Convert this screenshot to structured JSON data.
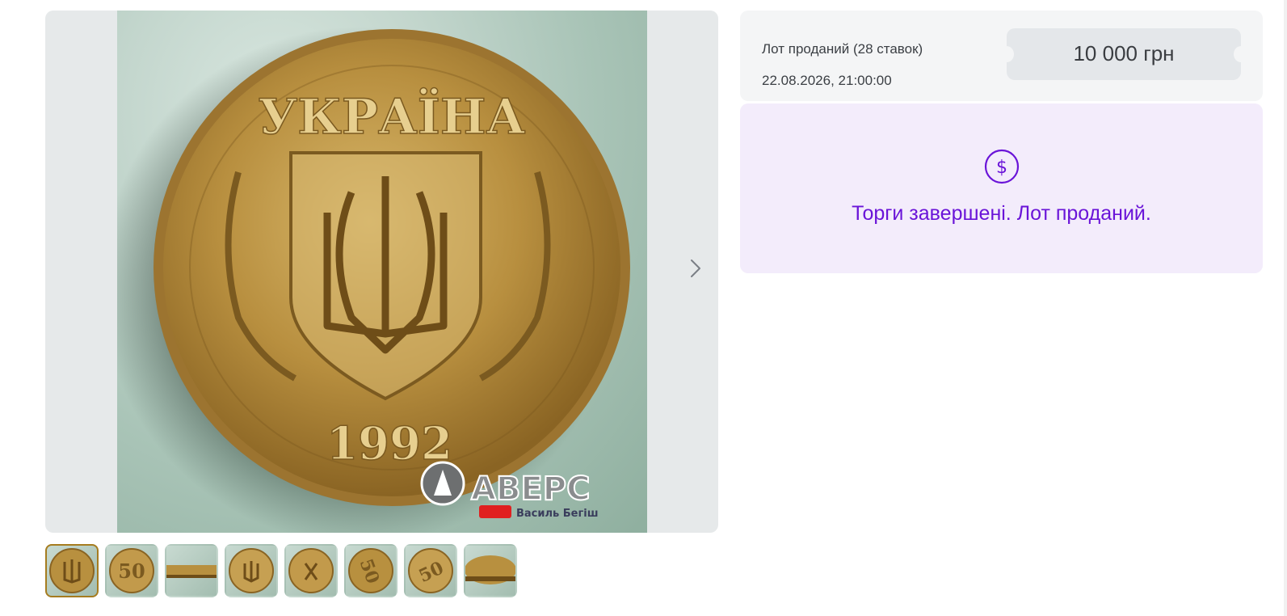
{
  "lot": {
    "status": "Лот проданий (28 ставок)",
    "end_datetime": "22.08.2026, 21:00:00",
    "price": "10 000 грн",
    "closed_message": "Торги завершені. Лот проданий."
  },
  "gallery": {
    "main_image": "coin-obverse-ukraine-1992",
    "coin_country_text": "УКРАЇНА",
    "coin_year_text": "1992",
    "watermark_brand": "АВЕРС",
    "watermark_subtitle": "Василь Бегіш",
    "next_icon": "chevron-right-icon",
    "thumbnails": [
      {
        "label": "obverse",
        "active": true
      },
      {
        "label": "reverse-50"
      },
      {
        "label": "edge"
      },
      {
        "label": "obverse-angle"
      },
      {
        "label": "obverse-detail"
      },
      {
        "label": "reverse-rotated"
      },
      {
        "label": "reverse-detail"
      },
      {
        "label": "reverse-edge"
      }
    ]
  },
  "colors": {
    "accent_purple": "#6a14d8",
    "closed_bg": "#f3ecfb",
    "card_bg": "#f4f5f6",
    "thumb_active_border": "#a67c1f"
  }
}
